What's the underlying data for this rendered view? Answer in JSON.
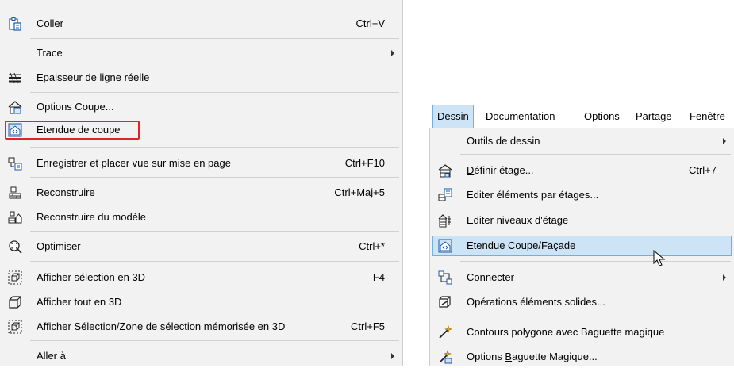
{
  "left_menu": {
    "items": [
      {
        "label": "Coller",
        "shortcut": "Ctrl+V",
        "icon": "paste-icon"
      },
      {
        "label": "Trace",
        "shortcut": "",
        "icon": "",
        "submenu": true
      },
      {
        "label": "Epaisseur de ligne réelle",
        "shortcut": "",
        "icon": "line-thickness-icon"
      },
      {
        "label": "Options Coupe...",
        "shortcut": "",
        "icon": "section-options-icon"
      },
      {
        "label": "Etendue de coupe",
        "shortcut": "",
        "icon": "section-range-icon"
      },
      {
        "label": "Enregistrer et placer vue sur mise en page",
        "shortcut": "Ctrl+F10",
        "icon": "save-place-view-icon"
      },
      {
        "label": "Reconstruire",
        "shortcut": "Ctrl+Maj+5",
        "icon": "rebuild-icon"
      },
      {
        "label": "Reconstruire du modèle",
        "shortcut": "",
        "icon": "rebuild-model-icon"
      },
      {
        "label": "Optimiser",
        "shortcut": "Ctrl+*",
        "icon": "zoom-fit-icon"
      },
      {
        "label": "Afficher sélection en 3D",
        "shortcut": "F4",
        "icon": "show-selection-3d-icon"
      },
      {
        "label": "Afficher tout en 3D",
        "shortcut": "",
        "icon": "show-all-3d-icon"
      },
      {
        "label": "Afficher Sélection/Zone de sélection mémorisée en 3D",
        "shortcut": "Ctrl+F5",
        "icon": "show-marquee-3d-icon"
      },
      {
        "label": "Aller à",
        "shortcut": "",
        "icon": "",
        "submenu": true
      }
    ]
  },
  "menubar": {
    "items": [
      "Dessin",
      "Documentation",
      "Options",
      "Partage",
      "Fenêtre"
    ]
  },
  "right_menu": {
    "items": [
      {
        "label": "Outils de dessin",
        "shortcut": "",
        "icon": "",
        "submenu": true
      },
      {
        "label": "Définir étage...",
        "shortcut": "Ctrl+7",
        "icon": "define-story-icon"
      },
      {
        "label": "Editer éléments par étages...",
        "shortcut": "",
        "icon": "edit-by-story-icon"
      },
      {
        "label": "Editer niveaux d'étage",
        "shortcut": "",
        "icon": "story-levels-icon"
      },
      {
        "label": "Etendue Coupe/Façade",
        "shortcut": "",
        "icon": "section-elevation-range-icon"
      },
      {
        "label": "Connecter",
        "shortcut": "",
        "icon": "connect-icon",
        "submenu": true
      },
      {
        "label": "Opérations éléments solides...",
        "shortcut": "",
        "icon": "solid-operations-icon"
      },
      {
        "label": "Contours polygone avec Baguette magique",
        "shortcut": "",
        "icon": "magic-wand-icon"
      },
      {
        "label": "Options Baguette Magique...",
        "shortcut": "",
        "icon": "magic-wand-options-icon"
      }
    ]
  }
}
